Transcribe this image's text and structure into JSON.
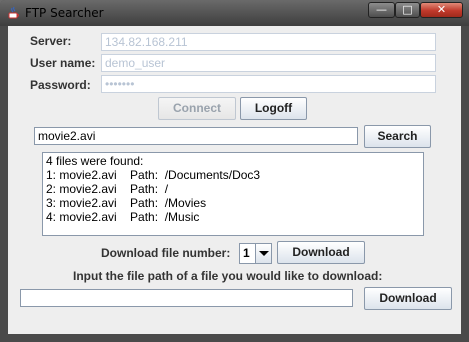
{
  "window": {
    "title": "FTP Searcher",
    "controls": {
      "minimize": "—",
      "maximize": "□",
      "close": "✕"
    }
  },
  "form": {
    "server_label": "Server:",
    "server_value": "134.82.168.211",
    "user_label": "User name:",
    "user_value": "demo_user",
    "password_label": "Password:",
    "password_value": "•••••••"
  },
  "buttons": {
    "connect": "Connect",
    "logoff": "Logoff",
    "search": "Search",
    "download_number": "Download",
    "download_path": "Download"
  },
  "search": {
    "query": "movie2.avi"
  },
  "results": [
    "4 files were found:",
    "1: movie2.avi    Path:  /Documents/Doc3",
    "2: movie2.avi    Path:  /",
    "3: movie2.avi    Path:  /Movies",
    "4: movie2.avi    Path:  /Music"
  ],
  "download": {
    "number_label": "Download file number:",
    "selected_number": "1",
    "path_label": "Input the file path of a file you would like to download:",
    "path_value": ""
  },
  "colors": {
    "accent_border": "#8a98aa",
    "disabled_text": "#b8c4d4"
  }
}
